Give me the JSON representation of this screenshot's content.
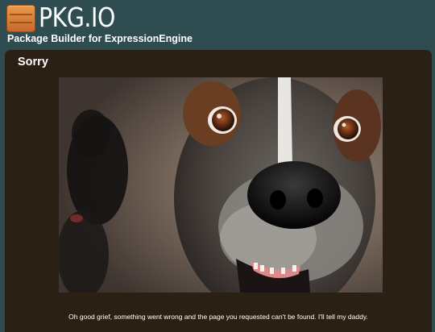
{
  "header": {
    "logo_text": "PKG.IO",
    "tagline": "Package Builder for ExpressionEngine",
    "logo_icon": "package-box-icon",
    "colors": {
      "header_bg": "#2f4d51",
      "panel_bg": "#2a2013",
      "logo_orange": "#e08a3c"
    }
  },
  "main": {
    "title": "Sorry",
    "image": {
      "semantic": "dog-photo"
    },
    "message": "Oh good grief, something went wrong and the page you requested can't be found. I'll tell my daddy."
  }
}
